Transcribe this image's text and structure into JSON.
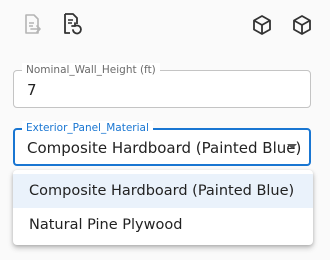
{
  "toolbar": {
    "icons": [
      "export-document-icon",
      "sync-document-icon",
      "cube-icon",
      "cube-icon"
    ]
  },
  "fields": {
    "nominal_wall_height": {
      "label": "Nominal_Wall_Height (ft)",
      "value": "7"
    },
    "exterior_panel_material": {
      "label": "Exterior_Panel_Material",
      "value": "Composite Hardboard (Painted Blue)",
      "options": [
        "Composite Hardboard (Painted Blue)",
        "Natural Pine Plywood"
      ]
    }
  },
  "colors": {
    "accent": "#1976d2",
    "selected_bg": "#eaf2fb",
    "icon": "#333333",
    "icon_disabled": "#b5b5b5"
  }
}
